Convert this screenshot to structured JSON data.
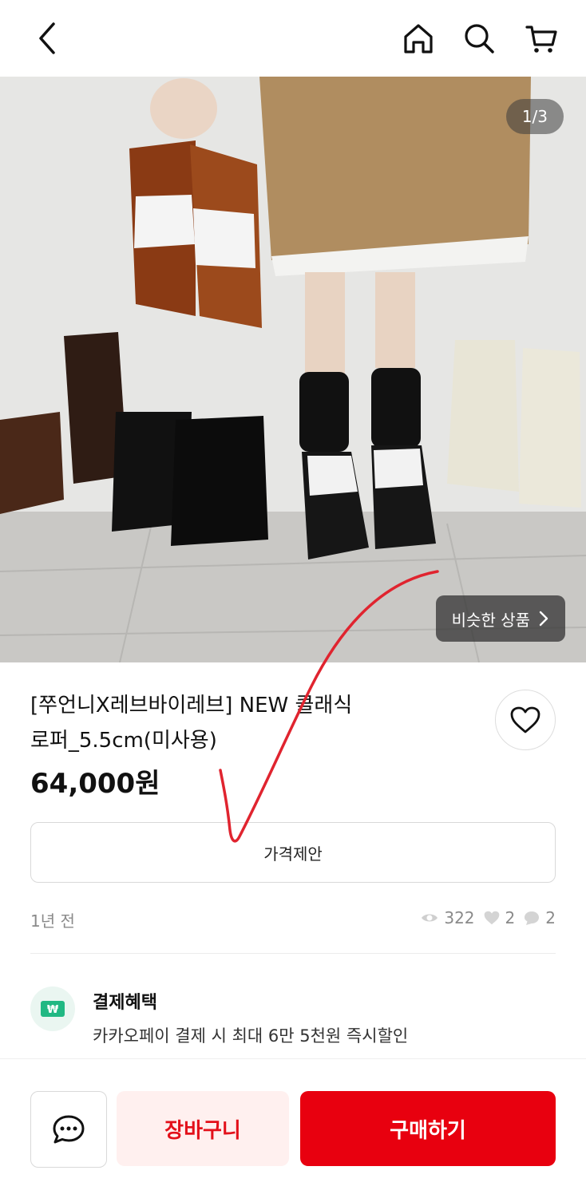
{
  "gallery": {
    "counter": "1/3",
    "similar_label": "비슷한 상품"
  },
  "product": {
    "title_line1": "[쭈언니X레브바이레브] NEW 클래식",
    "title_line2": "로퍼_5.5cm(미사용)",
    "price": "64,000원",
    "offer_label": "가격제안",
    "posted": "1년 전",
    "views": "322",
    "likes": "2",
    "chats": "2"
  },
  "benefit": {
    "title": "결제혜택",
    "description": "카카오페이 결제 시 최대 6만 5천원 즉시할인",
    "icon_text": "₩"
  },
  "actions": {
    "cart_label": "장바구니",
    "buy_label": "구매하기"
  },
  "colors": {
    "accent": "#e8000f",
    "cart_bg": "#fff0ef",
    "annotation": "#e0242f"
  }
}
